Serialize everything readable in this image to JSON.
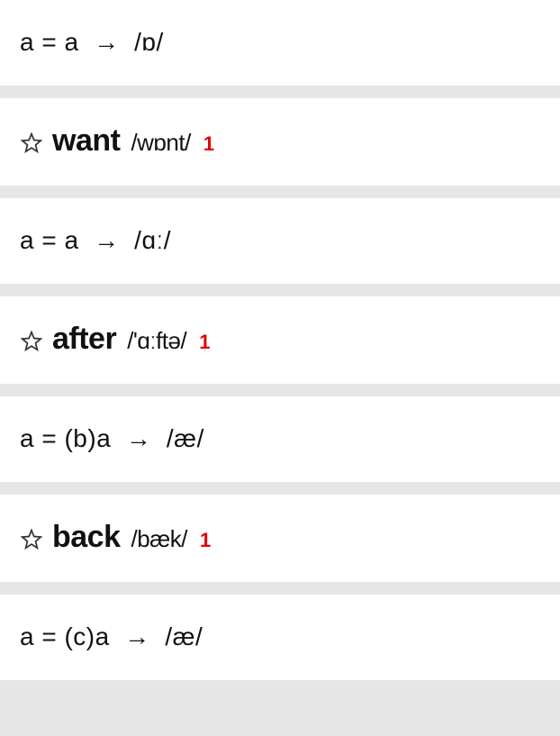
{
  "cards": [
    {
      "type": "rule",
      "text": "a = a  →  /ɒ/"
    },
    {
      "type": "word",
      "word": "want",
      "pron": "/wɒnt/",
      "count": "1"
    },
    {
      "type": "rule",
      "text": "a = a  →  /ɑː/"
    },
    {
      "type": "word",
      "word": "after",
      "pron": "/'ɑːftə/",
      "count": "1"
    },
    {
      "type": "rule",
      "text": "a = (b)a  →  /æ/"
    },
    {
      "type": "word",
      "word": "back",
      "pron": "/bæk/",
      "count": "1"
    },
    {
      "type": "rule",
      "text": "a = (c)a  →  /æ/"
    }
  ]
}
